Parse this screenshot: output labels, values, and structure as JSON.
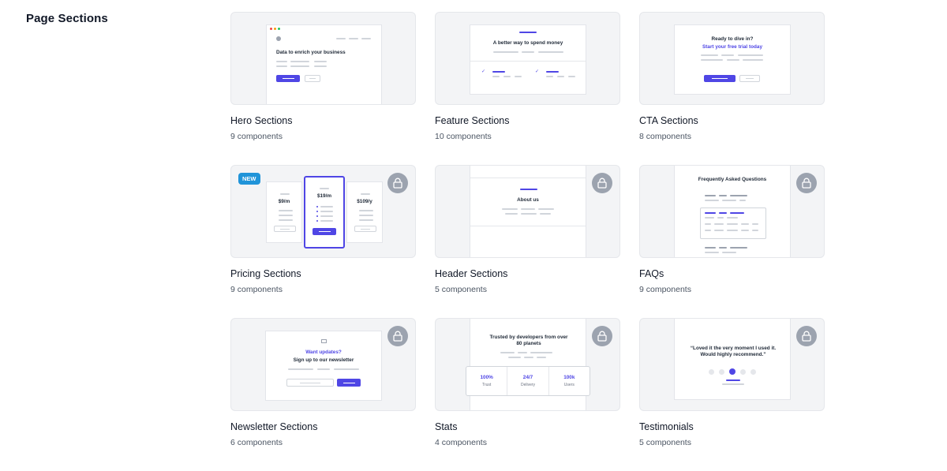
{
  "page": {
    "title": "Page Sections"
  },
  "icons": {
    "lock": "lock-icon"
  },
  "colors": {
    "accent": "#4f46e5",
    "badge": "#2094d9",
    "lock_bg": "#9ca3af"
  },
  "cards": [
    {
      "title": "Hero Sections",
      "count": "9 components",
      "locked": false,
      "preview": {
        "headline": "Data to enrich your business"
      }
    },
    {
      "title": "Feature Sections",
      "count": "10 components",
      "locked": false,
      "preview": {
        "headline": "A better way to spend money"
      }
    },
    {
      "title": "CTA Sections",
      "count": "8 components",
      "locked": false,
      "preview": {
        "line1": "Ready to dive in?",
        "line2": "Start your free trial today"
      }
    },
    {
      "title": "Pricing Sections",
      "count": "9 components",
      "locked": true,
      "badge": "NEW",
      "preview": {
        "price1": "$9/m",
        "price2": "$19/m",
        "price3": "$109/y"
      }
    },
    {
      "title": "Header Sections",
      "count": "5 components",
      "locked": true,
      "preview": {
        "headline": "About us"
      }
    },
    {
      "title": "FAQs",
      "count": "9 components",
      "locked": true,
      "preview": {
        "headline": "Frequently Asked Questions"
      }
    },
    {
      "title": "Newsletter Sections",
      "count": "6 components",
      "locked": true,
      "preview": {
        "line1": "Want updates?",
        "line2": "Sign up to our newsletter"
      }
    },
    {
      "title": "Stats",
      "count": "4 components",
      "locked": true,
      "preview": {
        "headline": "Trusted by developers from over 80 planets",
        "stats": [
          {
            "value": "100%",
            "label": "Trust"
          },
          {
            "value": "24/7",
            "label": "Delivery"
          },
          {
            "value": "100k",
            "label": "Users"
          }
        ]
      }
    },
    {
      "title": "Testimonials",
      "count": "5 components",
      "locked": true,
      "preview": {
        "quote": "“Loved it the very moment I used it. Would highly recommend.”"
      }
    }
  ]
}
